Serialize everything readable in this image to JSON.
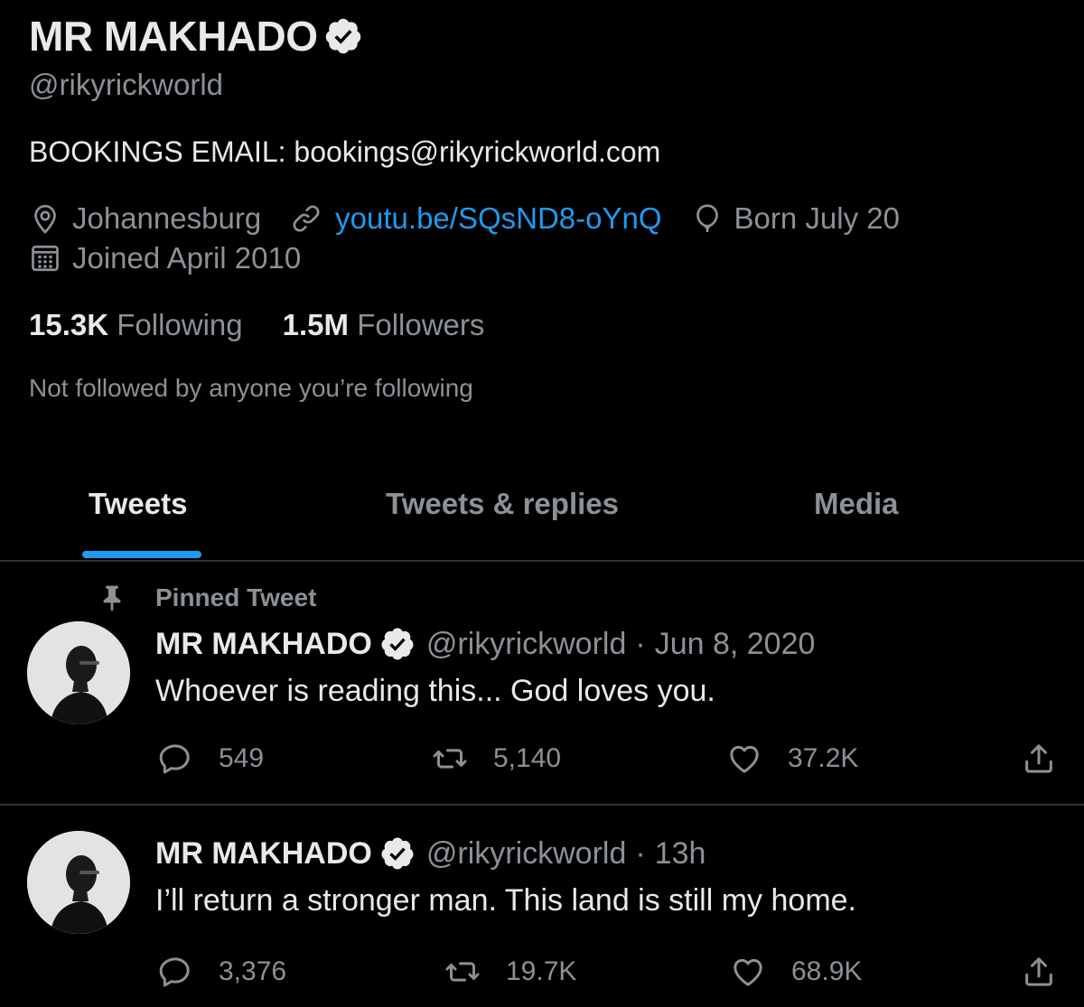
{
  "profile": {
    "display_name": "MR MAKHADO",
    "handle": "@rikyrickworld",
    "bio": "BOOKINGS EMAIL: bookings@rikyrickworld.com",
    "location": "Johannesburg",
    "website": "youtu.be/SQsND8-oYnQ",
    "birthday": "Born July 20",
    "joined": "Joined April 2010",
    "following_count": "15.3K",
    "following_label": "Following",
    "followers_count": "1.5M",
    "followers_label": "Followers",
    "followed_by_note": "Not followed by anyone you’re following"
  },
  "tabs": [
    {
      "label": "Tweets",
      "active": true
    },
    {
      "label": "Tweets & replies",
      "active": false
    },
    {
      "label": "Media",
      "active": false
    }
  ],
  "tweets": [
    {
      "pinned_label": "Pinned Tweet",
      "name": "MR MAKHADO",
      "handle": "@rikyrickworld",
      "separator": "·",
      "time": "Jun 8, 2020",
      "text": "Whoever is reading this... God loves you.",
      "replies": "549",
      "retweets": "5,140",
      "likes": "37.2K"
    },
    {
      "name": "MR MAKHADO",
      "handle": "@rikyrickworld",
      "separator": "·",
      "time": "13h",
      "text": "I’ll return a stronger man. This land is still my home.",
      "replies": "3,376",
      "retweets": "19.7K",
      "likes": "68.9K"
    }
  ],
  "icons": {
    "verified": "verified-badge-icon",
    "location": "location-pin-icon",
    "link": "link-icon",
    "birthday": "balloon-icon",
    "joined": "calendar-icon",
    "pinned": "pin-icon",
    "reply": "reply-icon",
    "retweet": "retweet-icon",
    "like": "heart-icon",
    "share": "share-icon"
  },
  "colors": {
    "background": "#000000",
    "primary_text": "#e7e9ea",
    "secondary_text": "#8b9196",
    "accent": "#1d9bf0",
    "divider": "#2f3336"
  }
}
